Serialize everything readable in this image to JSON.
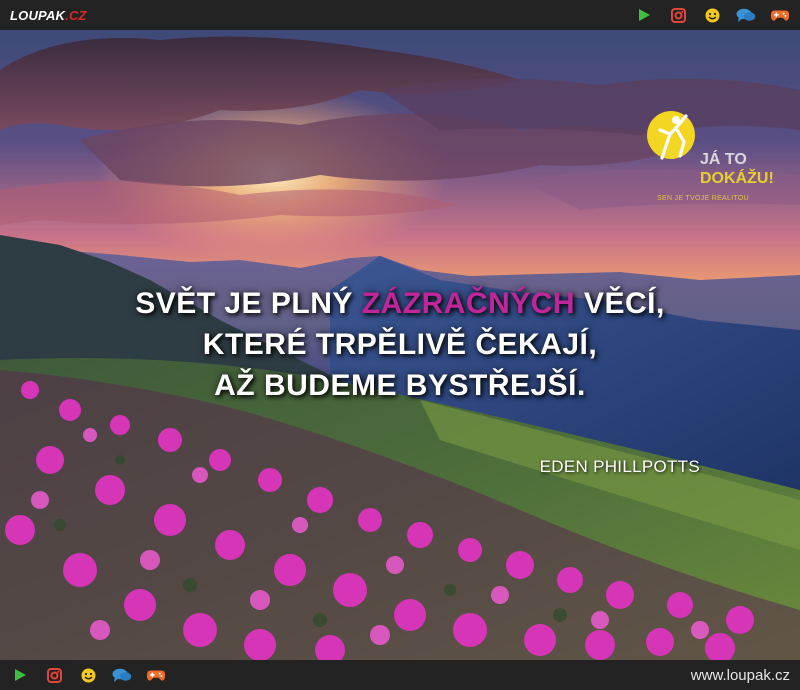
{
  "topbar": {
    "logo_main": "LOUPAK",
    "logo_dot": ".",
    "logo_tld": "CZ",
    "icons": [
      "play-icon",
      "instagram-icon",
      "smiley-icon",
      "chat-icon",
      "gamepad-icon"
    ]
  },
  "image": {
    "quote_part1": "SVĚT JE PLNÝ ",
    "quote_highlight": "ZÁZRAČNÝCH",
    "quote_part2": " VĚCÍ,",
    "quote_line2": "KTERÉ TRPĚLIVĚ ČEKAJÍ,",
    "quote_line3": "AŽ BUDEME BYSTŘEJŠÍ.",
    "author": "EDEN PHILLPOTTS",
    "badge_line1": "JÁ TO",
    "badge_line2": "DOKÁŽU!",
    "badge_sub": "SEN JE TVOJE REALITOU"
  },
  "bottombar": {
    "url": "www.loupak.cz",
    "icons": [
      "play-icon",
      "instagram-icon",
      "smiley-icon",
      "chat-icon",
      "gamepad-icon"
    ]
  },
  "colors": {
    "bar_bg": "#232323",
    "highlight": "#c0259a",
    "play": "#3fbf3f",
    "instagram": "#e0463a",
    "smiley": "#f2c81e",
    "chat": "#3a93d6",
    "gamepad": "#f06a28"
  }
}
